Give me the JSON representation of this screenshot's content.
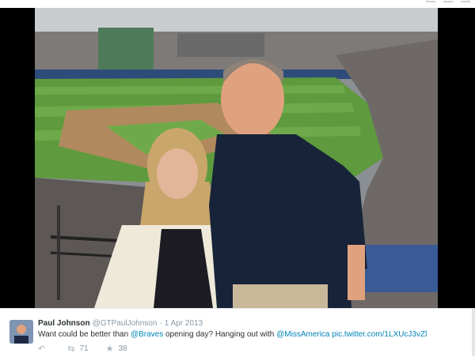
{
  "tweet": {
    "author_name": "Paul Johnson",
    "screen_name": "@GTPaulJohnson",
    "separator": "·",
    "timestamp": "1 Apr 2013",
    "text_parts": {
      "prefix": "Want could be better than ",
      "mention_braves": "@Braves",
      "middle": " opening day? Hanging out with ",
      "mention_missamerica": "@MissAmerica",
      "space": " ",
      "pic_link": "pic.twitter.com/1LXUcJ3vZl"
    },
    "actions": {
      "reply_icon": "reply-icon",
      "retweet_icon": "retweet-icon",
      "retweet_count": "71",
      "favorite_icon": "star-icon",
      "favorite_count": "38"
    }
  },
  "media": {
    "description_icon": "photo",
    "colors": {
      "field_green": "#5f9a3e",
      "dirt": "#b08a5e",
      "backdrop": "#000000",
      "link_blue": "#0084b4"
    }
  }
}
